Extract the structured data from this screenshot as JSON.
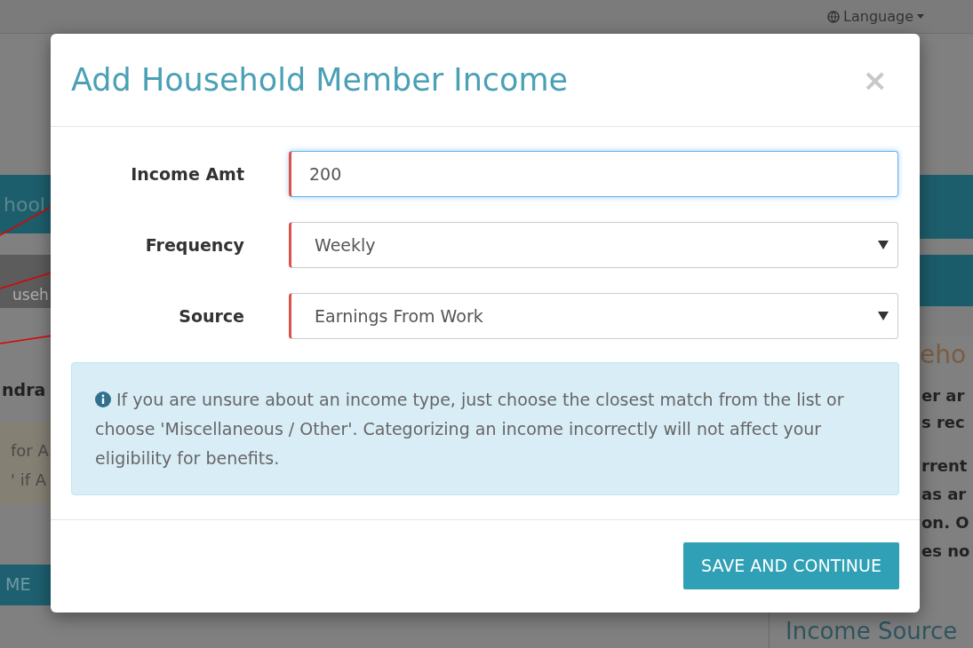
{
  "page": {
    "language_menu": "Language",
    "left_fragments": {
      "banner": "hool",
      "tab": "useh",
      "heading": "ndra",
      "notice_lines": [
        "for A",
        "' if A"
      ],
      "button": "ME"
    },
    "right_fragments": {
      "heading": "eho",
      "lines_1": [
        "er ar",
        "s rec"
      ],
      "lines_2": [
        "rrent",
        "as ar",
        "on. O",
        "es no"
      ],
      "panel_title": "Income Source"
    }
  },
  "modal": {
    "title": "Add Household Member Income",
    "close": "×",
    "fields": [
      {
        "label": "Income Amt",
        "kind": "input",
        "value": "200",
        "focused": true,
        "annotated": true
      },
      {
        "label": "Frequency",
        "kind": "select",
        "value": "Weekly",
        "focused": false,
        "annotated": true
      },
      {
        "label": "Source",
        "kind": "select",
        "value": "Earnings From Work",
        "focused": false,
        "annotated": true
      }
    ],
    "info": "If you are unsure about an income type, just choose the closest match from the list or choose 'Miscellaneous / Other'. Categorizing an income incorrectly will not affect your eligibility for benefits.",
    "button": "SAVE AND CONTINUE"
  }
}
